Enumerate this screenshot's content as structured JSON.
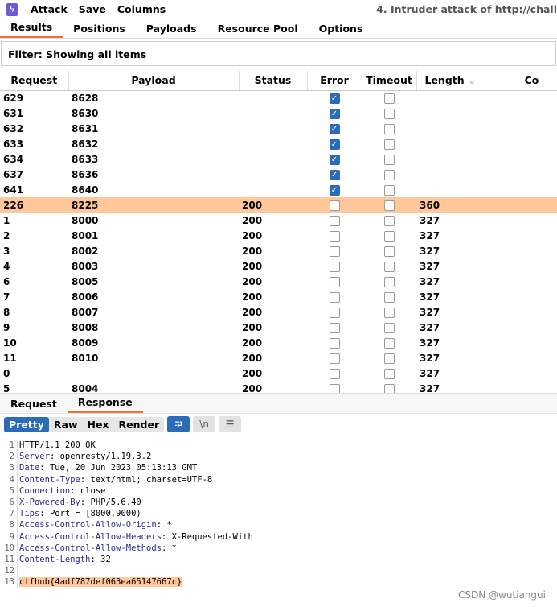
{
  "menubar": {
    "items": [
      "Attack",
      "Save",
      "Columns"
    ],
    "window_title": "4. Intruder attack of http://chall"
  },
  "tabs": [
    "Results",
    "Positions",
    "Payloads",
    "Resource Pool",
    "Options"
  ],
  "filter": "Filter: Showing all items",
  "table": {
    "columns": [
      "Request",
      "Payload",
      "Status",
      "Error",
      "Timeout",
      "Length",
      "Co"
    ],
    "rows": [
      {
        "request": "629",
        "payload": "8628",
        "status": "",
        "error": true,
        "timeout": false,
        "length": ""
      },
      {
        "request": "631",
        "payload": "8630",
        "status": "",
        "error": true,
        "timeout": false,
        "length": ""
      },
      {
        "request": "632",
        "payload": "8631",
        "status": "",
        "error": true,
        "timeout": false,
        "length": ""
      },
      {
        "request": "633",
        "payload": "8632",
        "status": "",
        "error": true,
        "timeout": false,
        "length": ""
      },
      {
        "request": "634",
        "payload": "8633",
        "status": "",
        "error": true,
        "timeout": false,
        "length": ""
      },
      {
        "request": "637",
        "payload": "8636",
        "status": "",
        "error": true,
        "timeout": false,
        "length": ""
      },
      {
        "request": "641",
        "payload": "8640",
        "status": "",
        "error": true,
        "timeout": false,
        "length": ""
      },
      {
        "request": "226",
        "payload": "8225",
        "status": "200",
        "error": false,
        "timeout": false,
        "length": "360",
        "selected": true
      },
      {
        "request": "1",
        "payload": "8000",
        "status": "200",
        "error": false,
        "timeout": false,
        "length": "327"
      },
      {
        "request": "2",
        "payload": "8001",
        "status": "200",
        "error": false,
        "timeout": false,
        "length": "327"
      },
      {
        "request": "3",
        "payload": "8002",
        "status": "200",
        "error": false,
        "timeout": false,
        "length": "327"
      },
      {
        "request": "4",
        "payload": "8003",
        "status": "200",
        "error": false,
        "timeout": false,
        "length": "327"
      },
      {
        "request": "6",
        "payload": "8005",
        "status": "200",
        "error": false,
        "timeout": false,
        "length": "327"
      },
      {
        "request": "7",
        "payload": "8006",
        "status": "200",
        "error": false,
        "timeout": false,
        "length": "327"
      },
      {
        "request": "8",
        "payload": "8007",
        "status": "200",
        "error": false,
        "timeout": false,
        "length": "327"
      },
      {
        "request": "9",
        "payload": "8008",
        "status": "200",
        "error": false,
        "timeout": false,
        "length": "327"
      },
      {
        "request": "10",
        "payload": "8009",
        "status": "200",
        "error": false,
        "timeout": false,
        "length": "327"
      },
      {
        "request": "11",
        "payload": "8010",
        "status": "200",
        "error": false,
        "timeout": false,
        "length": "327"
      },
      {
        "request": "0",
        "payload": "",
        "status": "200",
        "error": false,
        "timeout": false,
        "length": "327"
      },
      {
        "request": "5",
        "payload": "8004",
        "status": "200",
        "error": false,
        "timeout": false,
        "length": "327"
      }
    ]
  },
  "viewer": {
    "tabs": [
      "Request",
      "Response"
    ],
    "modes": [
      "Pretty",
      "Raw",
      "Hex",
      "Render"
    ],
    "icons": [
      "wrap-icon",
      "newline-icon",
      "menu-icon"
    ],
    "newline_label": "\\n",
    "lines": [
      {
        "key": "",
        "value": "HTTP/1.1 200 OK"
      },
      {
        "key": "Server",
        "value": ": openresty/1.19.3.2"
      },
      {
        "key": "Date",
        "value": ": Tue, 20 Jun 2023 05:13:13 GMT"
      },
      {
        "key": "Content-Type",
        "value": ": text/html; charset=UTF-8"
      },
      {
        "key": "Connection",
        "value": ": close"
      },
      {
        "key": "X-Powered-By",
        "value": ": PHP/5.6.40"
      },
      {
        "key": "Tips",
        "value": ": Port = [8000,9000)"
      },
      {
        "key": "Access-Control-Allow-Origin",
        "value": ": *"
      },
      {
        "key": "Access-Control-Allow-Headers",
        "value": ": X-Requested-With"
      },
      {
        "key": "Access-Control-Allow-Methods",
        "value": ": *"
      },
      {
        "key": "Content-Length",
        "value": ": 32"
      },
      {
        "key": "",
        "value": ""
      },
      {
        "key": "",
        "value": "ctfhub{4adf787def063ea65147667c}",
        "highlight": true
      }
    ]
  },
  "watermark": "CSDN @wutiangui"
}
